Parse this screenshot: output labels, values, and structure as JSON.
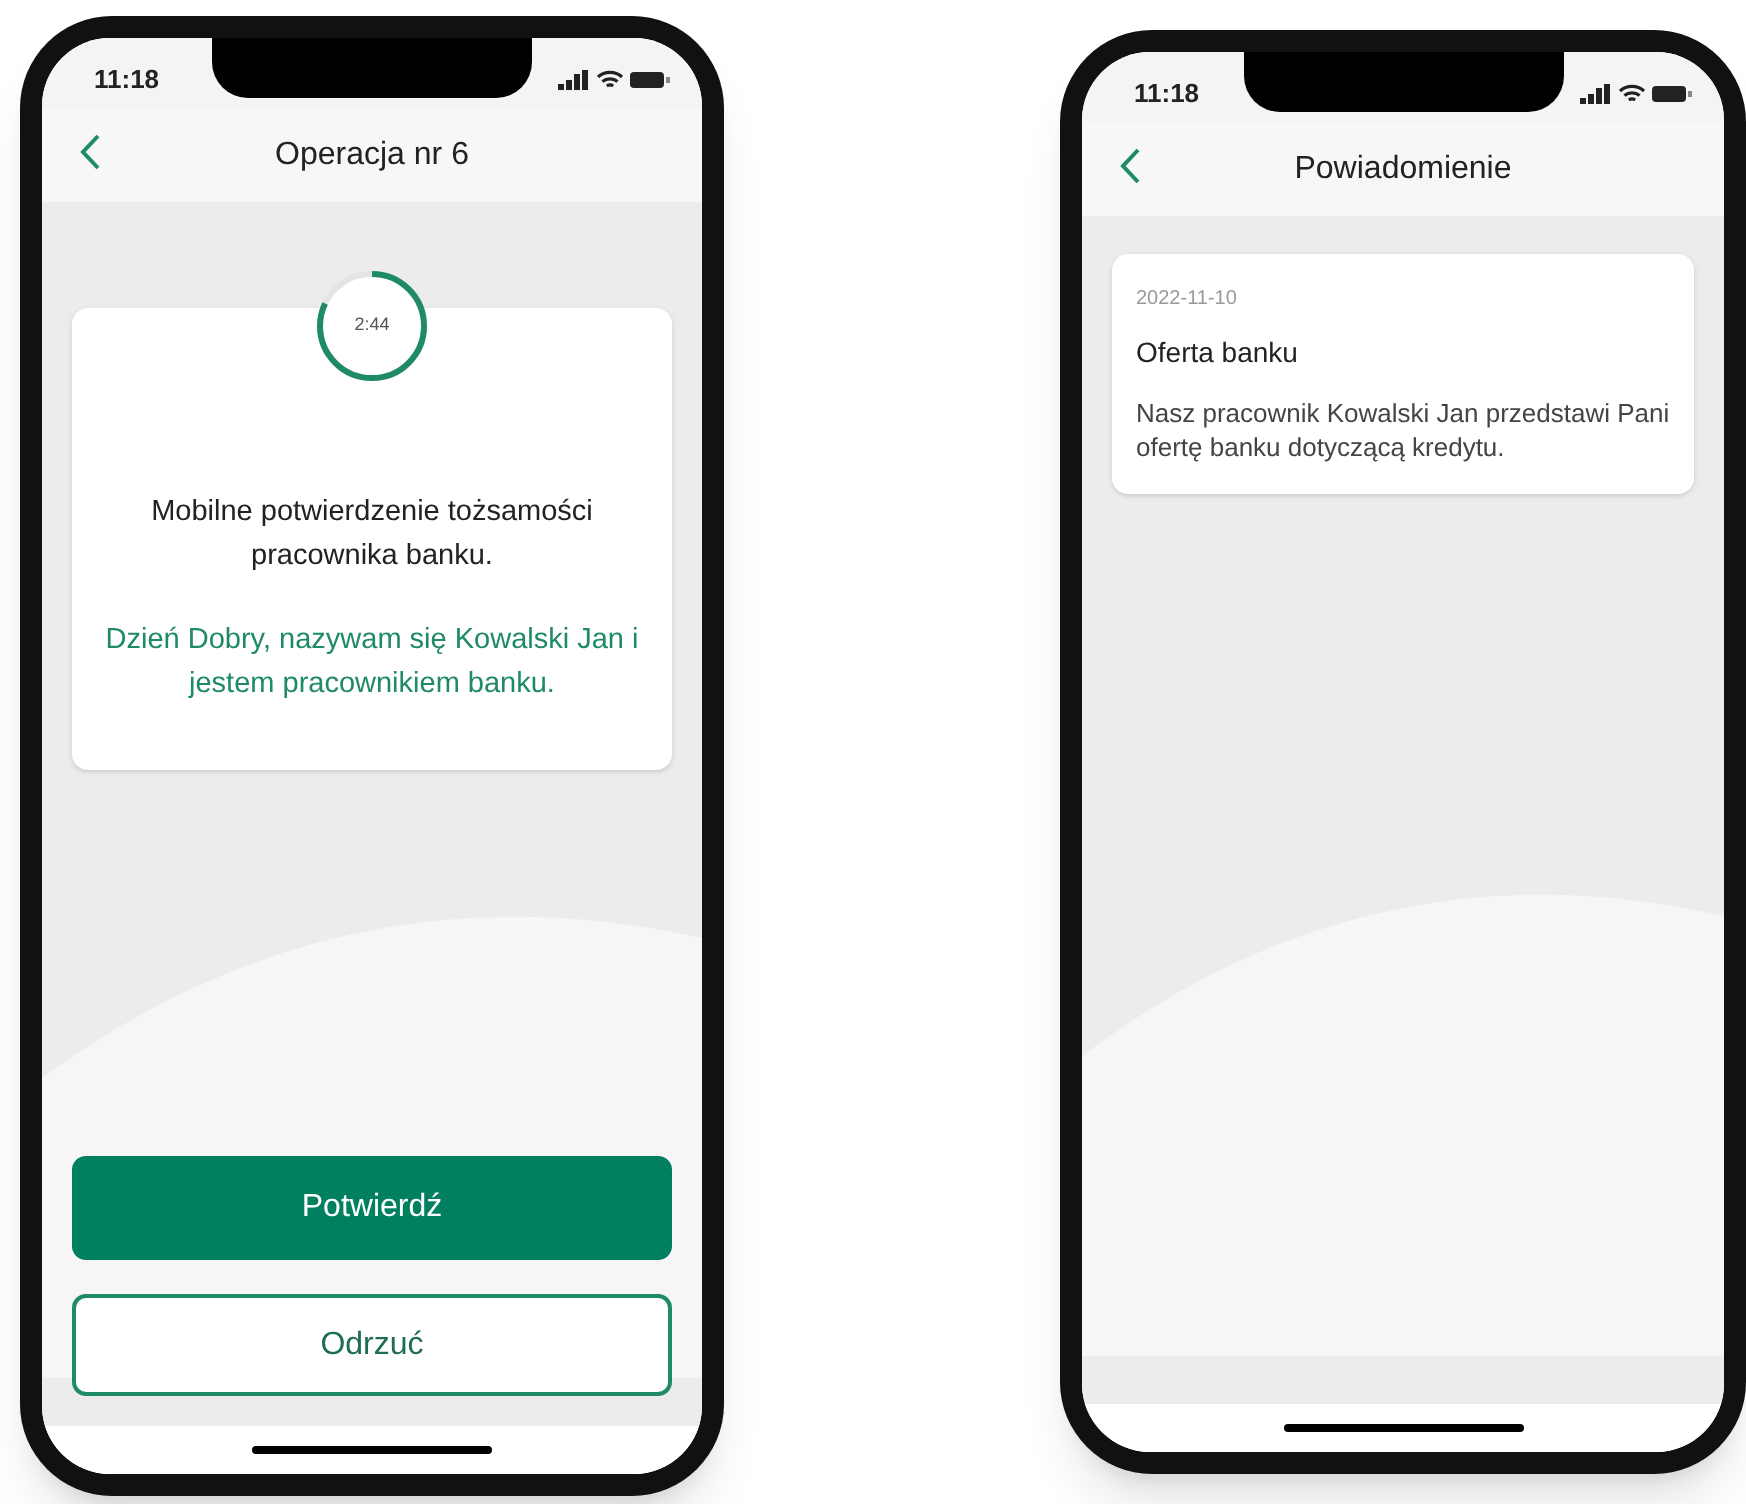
{
  "screens": [
    {
      "kind": "confirmation",
      "status_time": "11:18",
      "title": "Operacja nr 6",
      "timer": {
        "text": "2:44",
        "level": 0.82
      },
      "heading": "Mobilne potwierdzenie tożsamości pracownika banku.",
      "message": "Dzień Dobry, nazywam się Kowalski Jan i jestem pracownikiem banku.",
      "buttons": [
        {
          "label": "Potwierdź",
          "kind": "primary"
        },
        {
          "label": "Odrzuć",
          "kind": "secondary"
        }
      ]
    },
    {
      "kind": "notification",
      "status_time": "11:18",
      "title": "Powiadomienie",
      "notification": {
        "date": "2022-11-10",
        "title": "Oferta banku",
        "body": "Nasz pracownik Kowalski Jan przedstawi Pani ofertę banku dotyczącą kredytu."
      }
    }
  ]
}
